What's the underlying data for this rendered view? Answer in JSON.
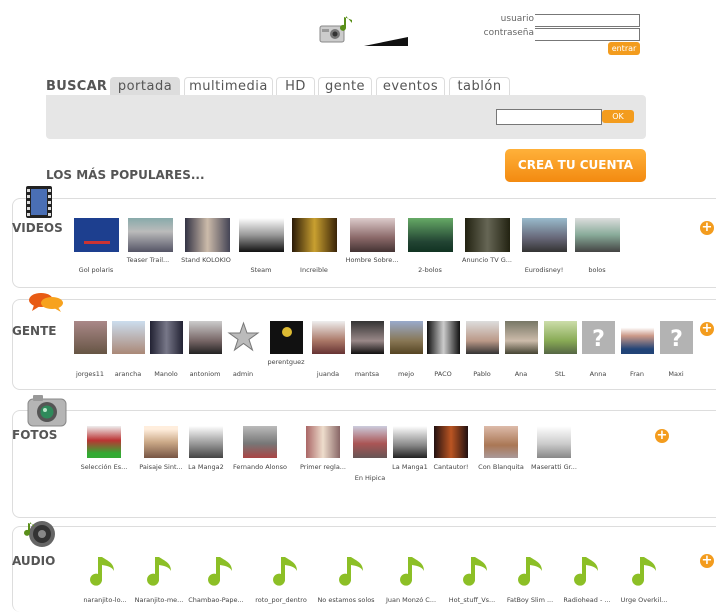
{
  "header": {
    "user_label": "usuario",
    "pass_label": "contraseña",
    "login_button": "entrar"
  },
  "tabs": {
    "search": "BUSCAR",
    "items": [
      "portada",
      "multimedia",
      "HD",
      "gente",
      "eventos",
      "tablón"
    ],
    "active": "portada",
    "ok_button": "OK"
  },
  "main": {
    "popular_heading": "LOS MÁS POPULARES...",
    "create_account": "CREA TU CUENTA"
  },
  "videos": {
    "title": "VIDEOS",
    "items": [
      "Gol polaris",
      "Teaser Trail...",
      "Stand KOLOKIO",
      "Steam",
      "Increible",
      "Hombre Sobre...",
      "2-bolos",
      "Anuncio TV G...",
      "Eurodisney!",
      "bolos"
    ]
  },
  "people": {
    "title": "GENTE",
    "items": [
      "jorges11",
      "arancha",
      "Manolo",
      "antoniom",
      "admin",
      "perentguez",
      "juanda",
      "mantsa",
      "mejo",
      "PACO",
      "Pablo",
      "Ana",
      "StL",
      "Anna",
      "Fran",
      "Maxi"
    ]
  },
  "photos": {
    "title": "FOTOS",
    "items": [
      "Selección Es...",
      "Paisaje Sint...",
      "La Manga2",
      "Fernando Alonso",
      "Primer regla...",
      "En Hipica",
      "La Manga1",
      "Cantautor!",
      "Con Blanquita",
      "Maseratti Gr..."
    ]
  },
  "audio": {
    "title": "AUDIO",
    "items": [
      "naranjito-lo...",
      "Naranjito-me...",
      "Chambao-Pape...",
      "roto_por_dentro",
      "No estamos solos",
      "Juan Monzó C...",
      "Hot_stuff_Vs...",
      "FatBoy Slim ...",
      "Radiohead - ...",
      "Urge Overkil..."
    ]
  },
  "colors": {
    "accent": "#f39c1e",
    "tab_bg": "#dddddd",
    "search_bg": "#e6e6e6"
  }
}
